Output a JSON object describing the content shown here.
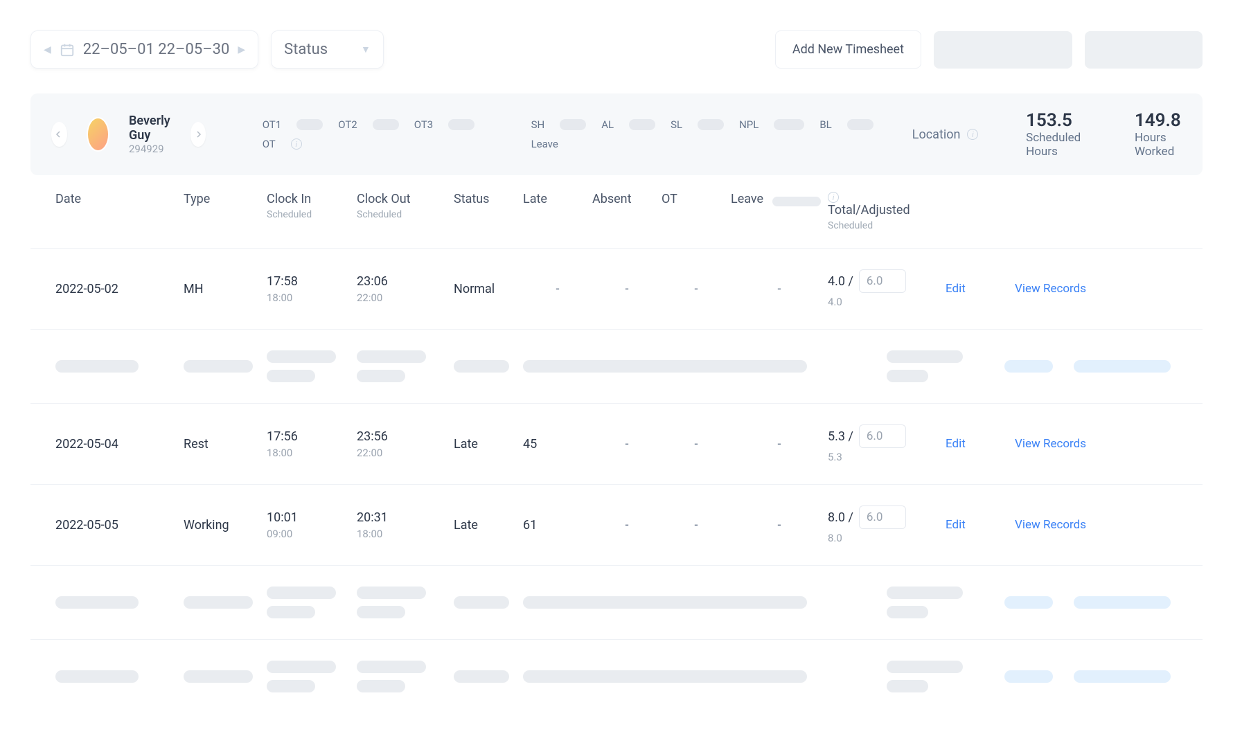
{
  "topbar": {
    "date_range": "22–05–01 22–05–30",
    "status_label": "Status",
    "add_button": "Add New Timesheet"
  },
  "employee": {
    "name": "Beverly Guy",
    "id": "294929",
    "ot_tags": [
      "OT1",
      "OT2",
      "OT3"
    ],
    "ot_sum_label": "OT",
    "leave_tags": [
      "SH",
      "AL",
      "SL",
      "NPL",
      "BL"
    ],
    "leave_sum_label": "Leave",
    "location_label": "Location",
    "scheduled_hours_val": "153.5",
    "scheduled_hours_lbl": "Scheduled Hours",
    "worked_hours_val": "149.8",
    "worked_hours_lbl": "Hours Worked"
  },
  "columns": {
    "date": "Date",
    "type": "Type",
    "clockin": "Clock In",
    "clockin_sub": "Scheduled",
    "clockout": "Clock Out",
    "clockout_sub": "Scheduled",
    "status": "Status",
    "late": "Late",
    "absent": "Absent",
    "ot": "OT",
    "leave": "Leave",
    "total": "Total/Adjusted",
    "total_sub": "Scheduled"
  },
  "rows": [
    {
      "date": "2022-05-02",
      "type": "MH",
      "clockin": "17:58",
      "clockin_sched": "18:00",
      "clockout": "23:06",
      "clockout_sched": "22:00",
      "status": "Normal",
      "late": "-",
      "absent": "-",
      "ot": "-",
      "leave": "-",
      "total": "4.0 /",
      "adj": "6.0",
      "total_sched": "4.0",
      "edit": "Edit",
      "view": "View Records"
    },
    {
      "date": "2022-05-04",
      "type": "Rest",
      "clockin": "17:56",
      "clockin_sched": "18:00",
      "clockout": "23:56",
      "clockout_sched": "22:00",
      "status": "Late",
      "late": "45",
      "absent": "-",
      "ot": "-",
      "leave": "-",
      "total": "5.3 /",
      "adj": "6.0",
      "total_sched": "5.3",
      "edit": "Edit",
      "view": "View Records"
    },
    {
      "date": "2022-05-05",
      "type": "Working",
      "clockin": "10:01",
      "clockin_sched": "09:00",
      "clockout": "20:31",
      "clockout_sched": "18:00",
      "status": "Late",
      "late": "61",
      "absent": "-",
      "ot": "-",
      "leave": "-",
      "total": "8.0 /",
      "adj": "6.0",
      "total_sched": "8.0",
      "edit": "Edit",
      "view": "View Records"
    }
  ],
  "dash": "-"
}
